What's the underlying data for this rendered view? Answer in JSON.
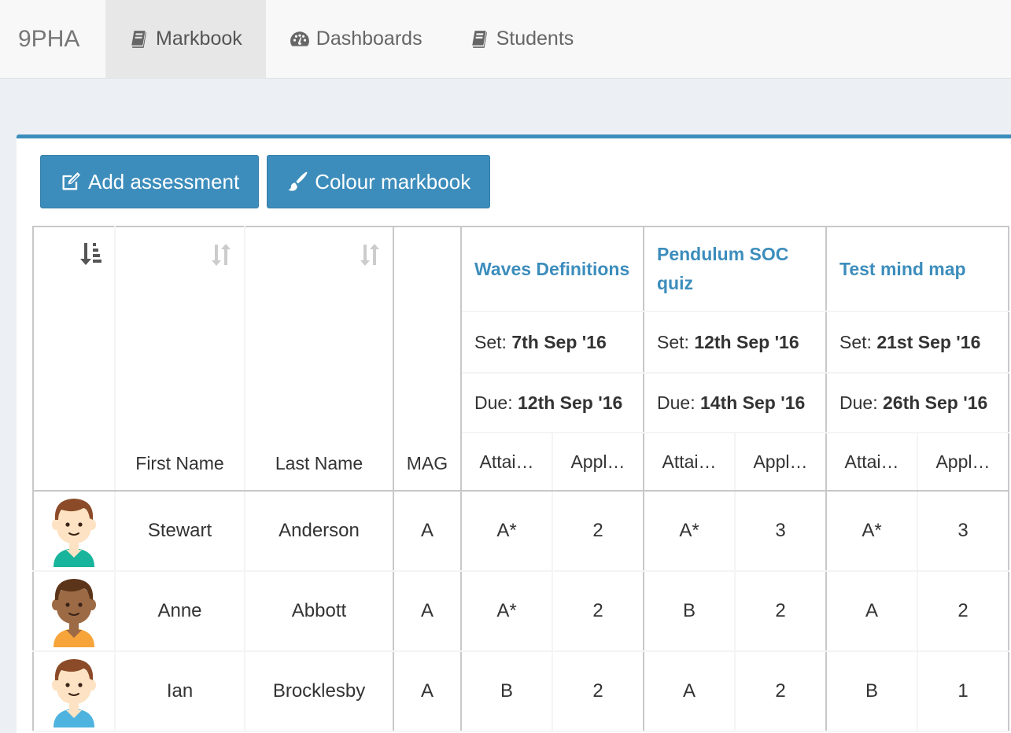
{
  "nav": {
    "brand": "9PHA",
    "items": [
      {
        "label": "Markbook",
        "icon": "book-icon",
        "active": true
      },
      {
        "label": "Dashboards",
        "icon": "dashboard-icon",
        "active": false
      },
      {
        "label": "Students",
        "icon": "book-icon",
        "active": false
      }
    ]
  },
  "toolbar": {
    "add_label": "Add assessment",
    "colour_label": "Colour markbook"
  },
  "table": {
    "headers": {
      "first_name": "First Name",
      "last_name": "Last Name",
      "mag": "MAG"
    },
    "assessments": [
      {
        "title": "Waves Definitions",
        "set_label": "Set:",
        "set": "7th Sep '16",
        "due_label": "Due:",
        "due": "12th Sep '16",
        "attainment": "Attai…",
        "application": "Appl…"
      },
      {
        "title": "Pendulum SOC quiz",
        "set_label": "Set:",
        "set": "12th Sep '16",
        "due_label": "Due:",
        "due": "14th Sep '16",
        "attainment": "Attai…",
        "application": "Appl…"
      },
      {
        "title": "Test mind map",
        "set_label": "Set:",
        "set": "21st Sep '16",
        "due_label": "Due:",
        "due": "26th Sep '16",
        "attainment": "Attai…",
        "application": "Appl…"
      }
    ],
    "rows": [
      {
        "first": "Stewart",
        "last": "Anderson",
        "mag": "A",
        "marks": [
          "A*",
          "2",
          "A*",
          "3",
          "A*",
          "3"
        ],
        "avatar": {
          "skin": "#fde3c4",
          "hair": "#8b4b28",
          "shirt": "#18b49b"
        }
      },
      {
        "first": "Anne",
        "last": "Abbott",
        "mag": "A",
        "marks": [
          "A*",
          "2",
          "B",
          "2",
          "A",
          "2"
        ],
        "avatar": {
          "skin": "#9c6a45",
          "hair": "#5b3419",
          "shirt": "#f7a43a"
        }
      },
      {
        "first": "Ian",
        "last": "Brocklesby",
        "mag": "A",
        "marks": [
          "B",
          "2",
          "A",
          "2",
          "B",
          "1"
        ],
        "avatar": {
          "skin": "#fde3c4",
          "hair": "#8b4b28",
          "shirt": "#4fb3e0"
        }
      }
    ]
  },
  "colors": {
    "accent": "#3c8dbc",
    "background": "#ecf0f5"
  }
}
